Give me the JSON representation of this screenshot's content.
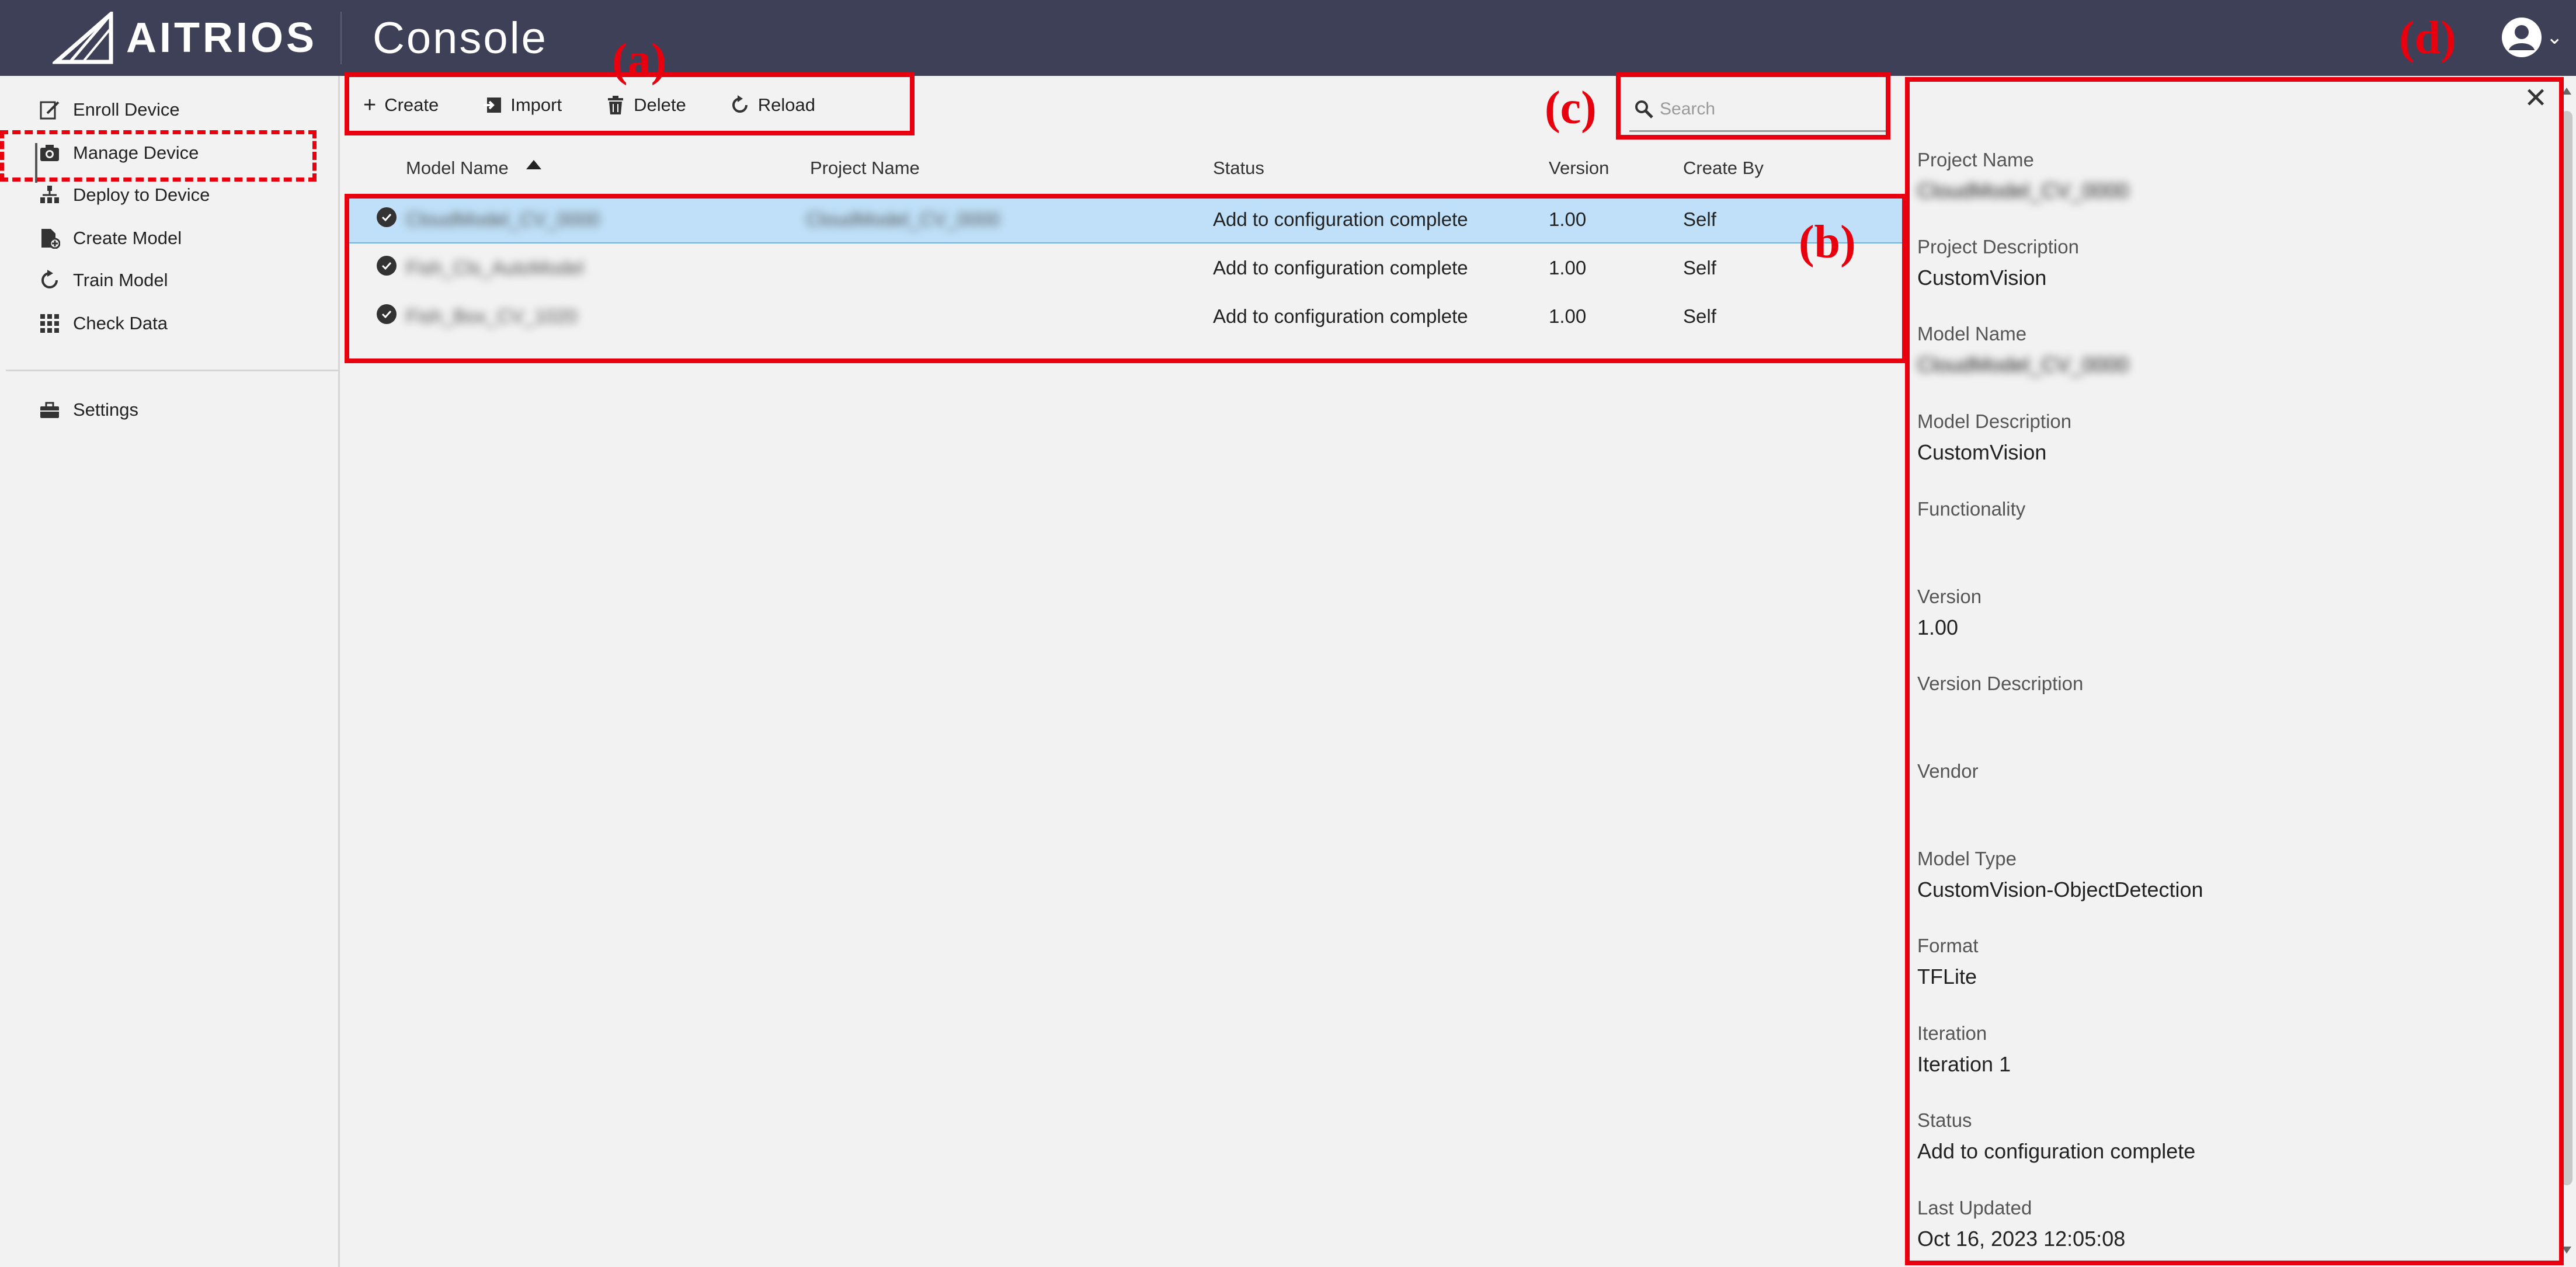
{
  "header": {
    "brand": "AITRIOS",
    "app_title": "Console"
  },
  "sidebar": {
    "items": [
      {
        "label": "Enroll Device",
        "icon": "edit-icon"
      },
      {
        "label": "Manage Device",
        "icon": "camera-icon"
      },
      {
        "label": "Deploy to Device",
        "icon": "deploy-icon"
      },
      {
        "label": "Create Model",
        "icon": "document-add-icon",
        "active": true
      },
      {
        "label": "Train Model",
        "icon": "refresh-icon"
      },
      {
        "label": "Check Data",
        "icon": "grid-icon"
      }
    ],
    "settings_label": "Settings"
  },
  "toolbar": {
    "create_label": "Create",
    "import_label": "Import",
    "delete_label": "Delete",
    "reload_label": "Reload"
  },
  "search": {
    "placeholder": "Search"
  },
  "table": {
    "columns": [
      "Model Name",
      "Project Name",
      "Status",
      "Version",
      "Create By"
    ],
    "rows": [
      {
        "model_name": "CloudModel_CV_0000",
        "project_name": "CloudModel_CV_0000",
        "status": "Add to configuration complete",
        "version": "1.00",
        "create_by": "Self",
        "selected": true
      },
      {
        "model_name": "Fish_Cls_AutoModel",
        "project_name": "",
        "status": "Add to configuration complete",
        "version": "1.00",
        "create_by": "Self"
      },
      {
        "model_name": "Fish_Box_CV_1020",
        "project_name": "",
        "status": "Add to configuration complete",
        "version": "1.00",
        "create_by": "Self"
      }
    ]
  },
  "detail": {
    "fields": [
      {
        "label": "Project Name",
        "value": "CloudModel_CV_0000",
        "blurred": true
      },
      {
        "label": "Project Description",
        "value": "CustomVision"
      },
      {
        "label": "Model Name",
        "value": "CloudModel_CV_0000",
        "blurred": true
      },
      {
        "label": "Model Description",
        "value": "CustomVision"
      },
      {
        "label": "Functionality",
        "value": ""
      },
      {
        "label": "Version",
        "value": "1.00"
      },
      {
        "label": "Version Description",
        "value": ""
      },
      {
        "label": "Vendor",
        "value": ""
      },
      {
        "label": "Model Type",
        "value": "CustomVision-ObjectDetection"
      },
      {
        "label": "Format",
        "value": "TFLite"
      },
      {
        "label": "Iteration",
        "value": "Iteration 1"
      },
      {
        "label": "Status",
        "value": "Add to configuration complete"
      },
      {
        "label": "Last Updated",
        "value": "Oct 16, 2023 12:05:08"
      }
    ]
  },
  "annotations": {
    "a": "(a)",
    "b": "(b)",
    "c": "(c)",
    "d": "(d)"
  },
  "colors": {
    "topbar": "#3e4057",
    "selected_row": "#bfe0f8",
    "annotation_red": "#e8000f"
  }
}
